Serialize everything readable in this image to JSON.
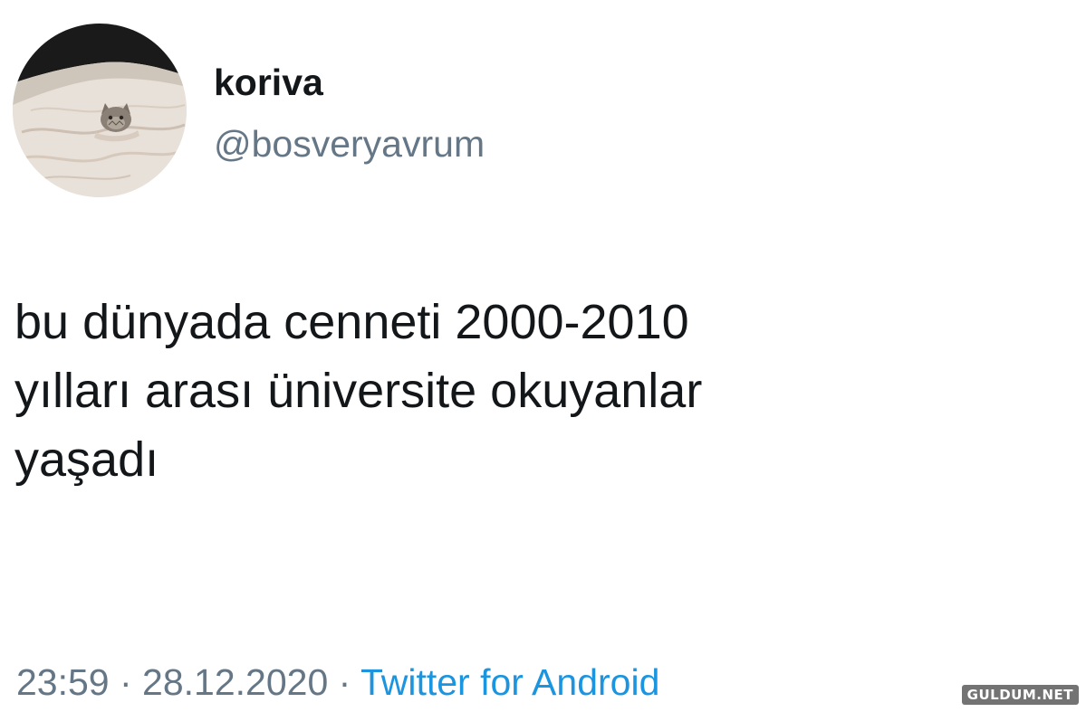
{
  "author": {
    "display_name": "koriva",
    "handle": "@bosveryavrum",
    "avatar_icon": "cat-in-blanket-avatar"
  },
  "tweet": {
    "text_lines": [
      "bu dünyada cenneti 2000-2010",
      "yılları arası üniversite okuyanlar",
      "yaşadı"
    ]
  },
  "meta": {
    "time": "23:59",
    "separator": " · ",
    "date": "28.12.2020",
    "source": "Twitter for Android"
  },
  "watermark": {
    "text": "GULDUM.NET"
  },
  "colors": {
    "text": "#14171a",
    "secondary": "#657786",
    "link": "#1b95e0",
    "background": "#ffffff"
  }
}
